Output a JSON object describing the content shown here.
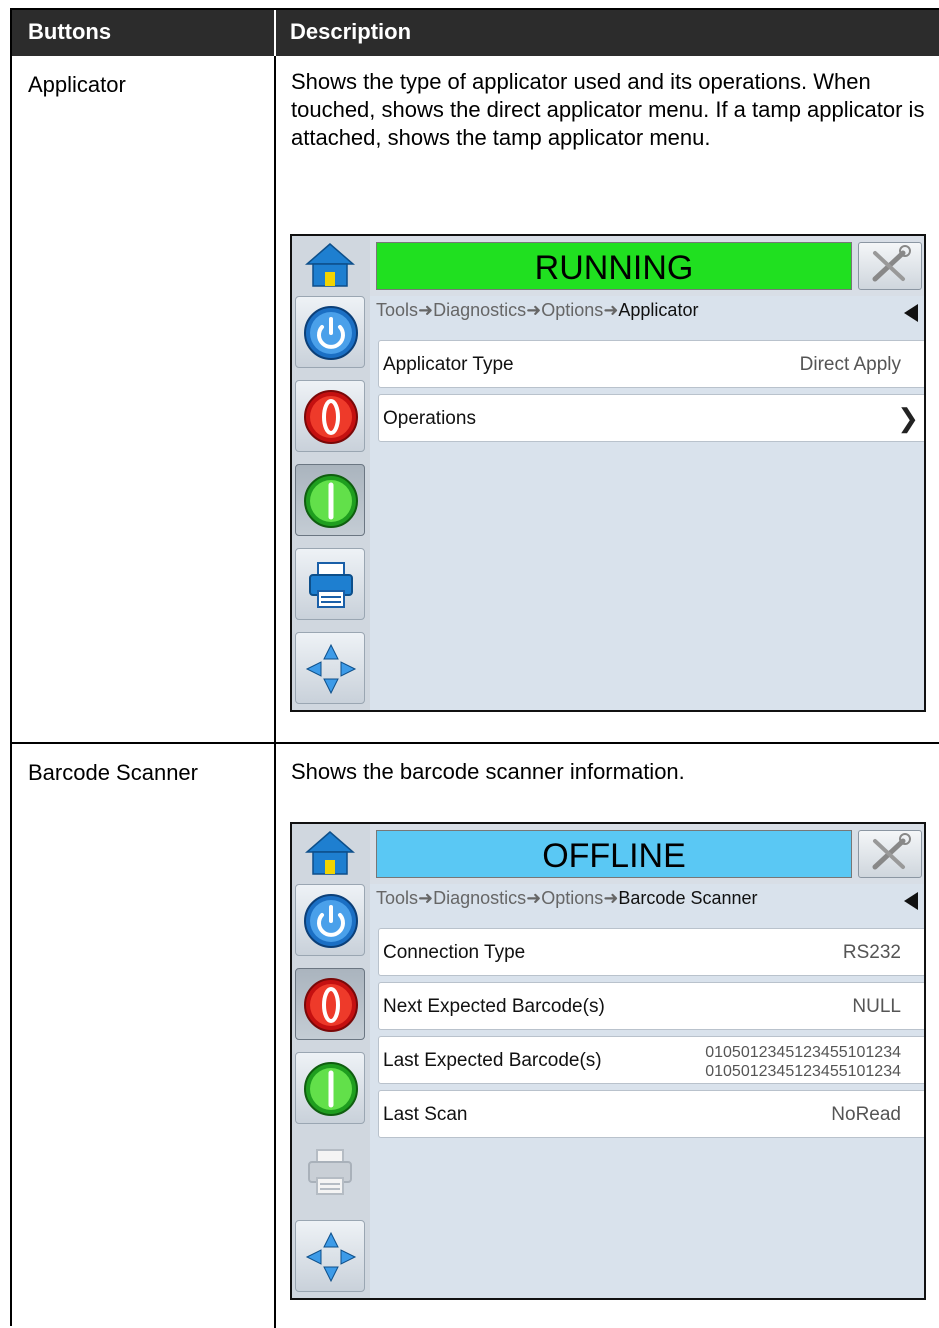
{
  "header": {
    "col1": "Buttons",
    "col2": "Description"
  },
  "rows": [
    {
      "name": "Applicator",
      "description": "Shows the type of applicator used and its operations. When touched, shows the direct applicator menu. If a tamp applicator is attached, shows the tamp applicator menu.",
      "screen": {
        "status": "RUNNING",
        "status_color": "#20e020",
        "breadcrumb": [
          "Tools",
          "Diagnostics",
          "Options",
          "Applicator"
        ],
        "items": [
          {
            "label": "Applicator Type",
            "value": "Direct Apply"
          },
          {
            "label": "Operations",
            "value": ""
          }
        ]
      }
    },
    {
      "name": "Barcode Scanner",
      "description": "Shows the barcode scanner information.",
      "screen": {
        "status": "OFFLINE",
        "status_color": "#5ac8f4",
        "breadcrumb": [
          "Tools",
          "Diagnostics",
          "Options",
          "Barcode Scanner"
        ],
        "items": [
          {
            "label": "Connection Type",
            "value": "RS232"
          },
          {
            "label": "Next Expected Barcode(s)",
            "value": "NULL"
          },
          {
            "label": "Last Expected Barcode(s)",
            "value_lines": [
              "0105012345123455101234",
              "0105012345123455101234"
            ]
          },
          {
            "label": "Last Scan",
            "value": "NoRead"
          }
        ]
      }
    }
  ],
  "icons": [
    "home-icon",
    "tools-icon",
    "shutdown-icon",
    "stop-icon",
    "start-icon",
    "printer-icon",
    "navigation-arrows-icon",
    "back-arrow-icon",
    "chevron-right-icon"
  ]
}
